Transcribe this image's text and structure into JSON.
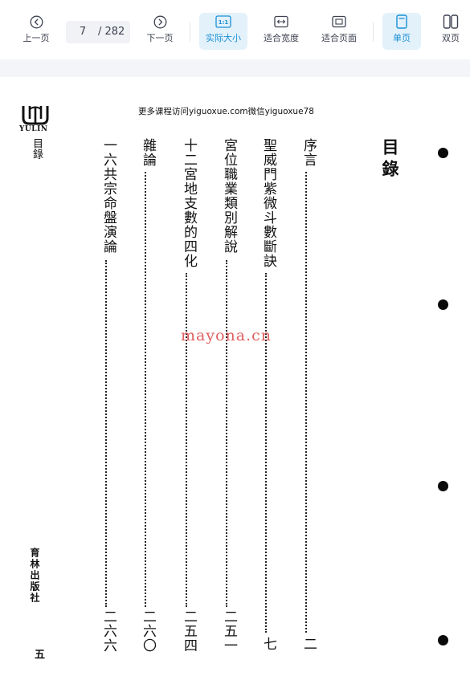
{
  "toolbar": {
    "prev_label": "上一页",
    "current_page": "7",
    "total_pages": "/ 282",
    "next_label": "下一页",
    "actual_size_label": "实际大小",
    "actual_size_icon_text": "1:1",
    "fit_width_label": "适合宽度",
    "fit_page_label": "适合页面",
    "single_page_label": "单页",
    "double_page_label": "双页"
  },
  "document": {
    "header_line": "更多课程访问yiguoxue.com微信yiguoxue78",
    "logo_text": "YULIN",
    "title": "目錄",
    "side_label": "目錄",
    "publisher": "育林出版社",
    "page_number": "五",
    "watermark": "mayona.cn",
    "entries": [
      {
        "title": "序言",
        "page": "二"
      },
      {
        "title": "聖威門紫微斗數斷訣",
        "page": "七"
      },
      {
        "title": "宮位職業類別解說",
        "page": "二五一"
      },
      {
        "title": "十二宮地支數的四化",
        "page": "二五四"
      },
      {
        "title": "雜論",
        "page": "二六〇"
      },
      {
        "title": "一六共宗命盤演論",
        "page": "二六六"
      }
    ]
  }
}
